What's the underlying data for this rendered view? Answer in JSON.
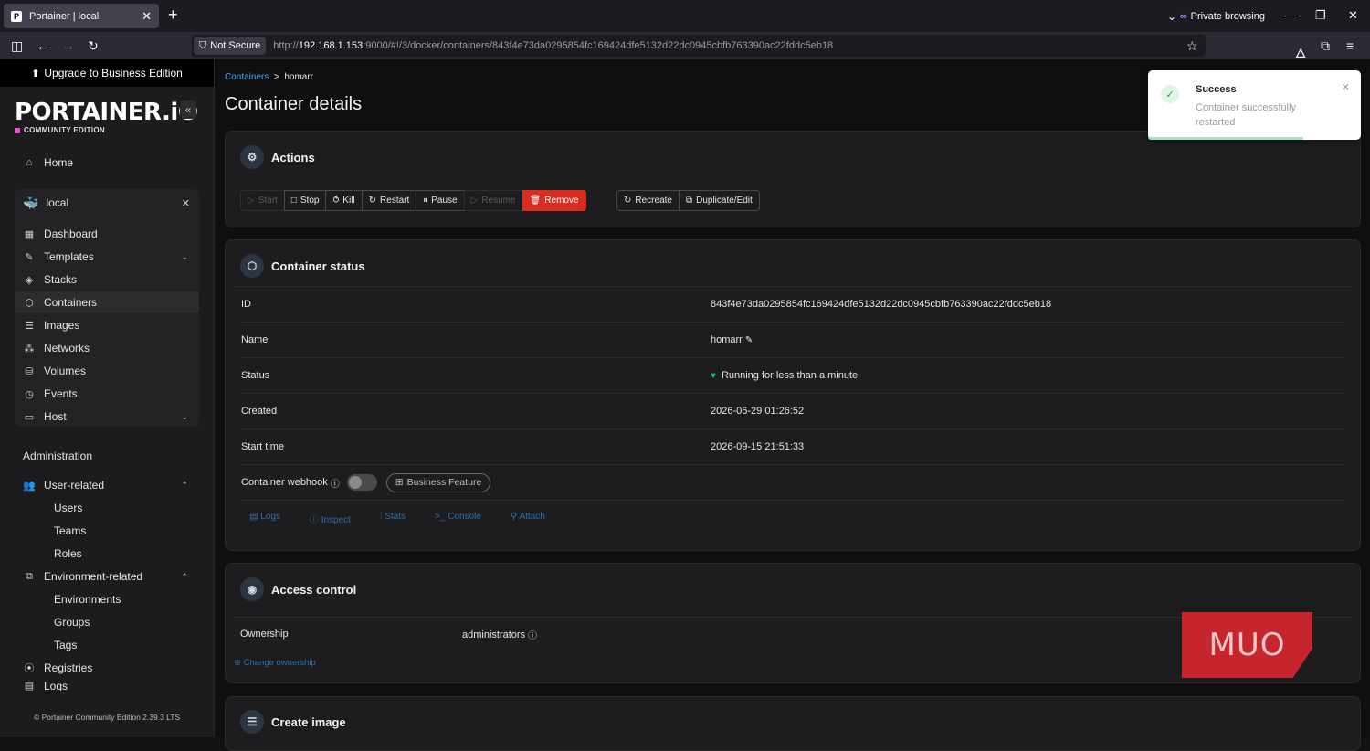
{
  "browser": {
    "tab_title": "Portainer | local",
    "private_label": "Private browsing",
    "not_secure": "Not Secure",
    "url_prefix": "http://",
    "url_host": "192.168.1.153",
    "url_rest": ":9000/#!/3/docker/containers/843f4e73da0295854fc169424dfe5132d22dc0945cbfb763390ac22fddc5eb18"
  },
  "sidebar": {
    "upgrade": "Upgrade to Business Edition",
    "logo": "PORTAINER.iO",
    "logo_sub": "COMMUNITY EDITION",
    "home": "Home",
    "environment": "local",
    "env_items": [
      "Dashboard",
      "Templates",
      "Stacks",
      "Containers",
      "Images",
      "Networks",
      "Volumes",
      "Events",
      "Host"
    ],
    "admin_label": "Administration",
    "user_related": "User-related",
    "user_items": [
      "Users",
      "Teams",
      "Roles"
    ],
    "env_related": "Environment-related",
    "env_related_items": [
      "Environments",
      "Groups",
      "Tags"
    ],
    "registries": "Registries",
    "logs": "Logs",
    "footer": "Portainer Community Edition 2.39.3 LTS"
  },
  "main": {
    "breadcrumb_link": "Containers",
    "breadcrumb_sep": ">",
    "breadcrumb_current": "homarr",
    "title": "Container details",
    "actions": {
      "title": "Actions",
      "buttons": [
        "Start",
        "Stop",
        "Kill",
        "Restart",
        "Pause",
        "Resume",
        "Remove"
      ],
      "buttons2": [
        "Recreate",
        "Duplicate/Edit"
      ]
    },
    "status": {
      "title": "Container status",
      "rows": [
        {
          "label": "ID",
          "value": "843f4e73da0295854fc169424dfe5132d22dc0945cbfb763390ac22fddc5eb18"
        },
        {
          "label": "Name",
          "value": "homarr"
        },
        {
          "label": "Status",
          "value": "Running for less than a minute"
        },
        {
          "label": "Created",
          "value": "2026-06-29 01:26:52"
        },
        {
          "label": "Start time",
          "value": "2026-09-15 21:51:33"
        }
      ],
      "webhook_label": "Container webhook",
      "business_feature": "Business Feature",
      "quick_links": [
        "Logs",
        "Inspect",
        "Stats",
        "Console",
        "Attach"
      ]
    },
    "access": {
      "title": "Access control",
      "ownership_label": "Ownership",
      "ownership_value": "administrators",
      "change_link": "Change ownership"
    },
    "create_image": {
      "title": "Create image"
    }
  },
  "toast": {
    "title": "Success",
    "message": "Container successfully restarted"
  },
  "watermark": "MUO"
}
